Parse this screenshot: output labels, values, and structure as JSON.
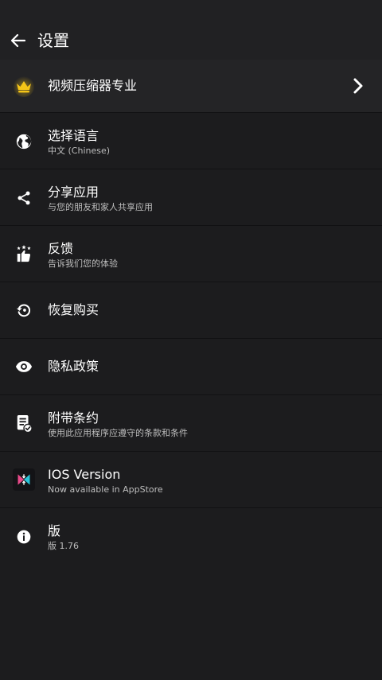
{
  "header": {
    "title": "设置"
  },
  "pro": {
    "title": "视频压缩器专业"
  },
  "items": [
    {
      "title": "选择语言",
      "subtitle": "中文 (Chinese)"
    },
    {
      "title": "分享应用",
      "subtitle": "与您的朋友和家人共享应用"
    },
    {
      "title": "反馈",
      "subtitle": "告诉我们您的体验"
    },
    {
      "title": "恢复购买"
    },
    {
      "title": "隐私政策"
    },
    {
      "title": "附带条约",
      "subtitle": "使用此应用程序应遵守的条款和条件"
    },
    {
      "title": "IOS Version",
      "subtitle": "Now available in AppStore"
    },
    {
      "title": "版",
      "subtitle": "版 1.76"
    }
  ],
  "icons": {
    "back": "arrow-left-icon",
    "pro": "crown-icon",
    "chevron": "chevron-right-icon",
    "language": "globe-icon",
    "share": "share-icon",
    "feedback": "thumbs-up-stars-icon",
    "restore": "restore-icon",
    "privacy": "eye-icon",
    "terms": "document-check-icon",
    "ios": "app-logo-icon",
    "version": "info-icon"
  },
  "colors": {
    "background": "#1c1c1e",
    "header": "#212123",
    "crown": "#f5c518",
    "text": "#ffffff",
    "subtext": "#bdbdbd",
    "logo_pink": "#e94a8a",
    "logo_cyan": "#27c3d8"
  }
}
